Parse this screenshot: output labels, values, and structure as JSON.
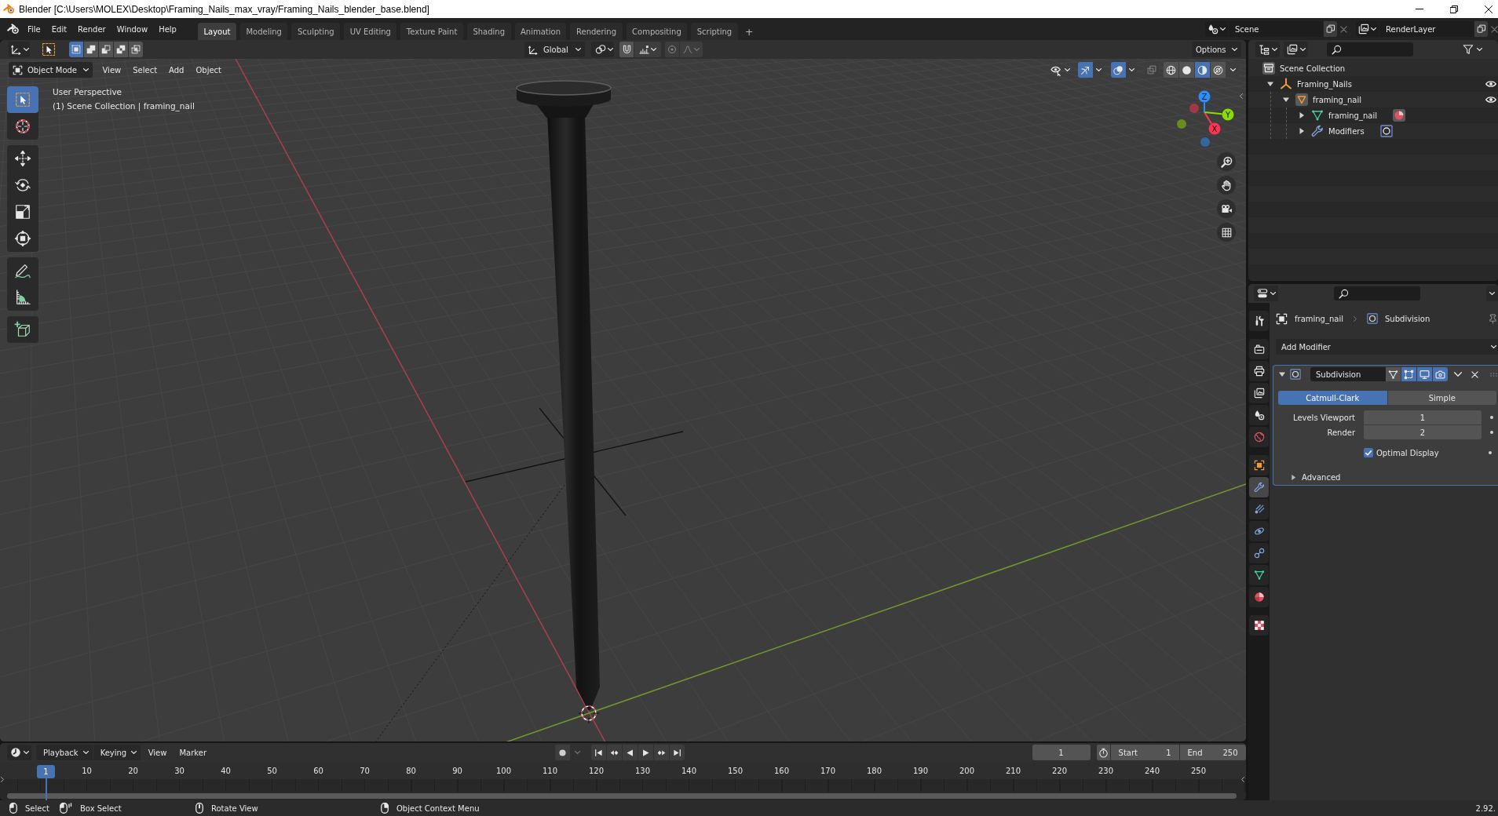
{
  "window": {
    "title": "Blender [C:\\Users\\MOLEX\\Desktop\\Framing_Nails_max_vray/Framing_Nails_blender_base.blend]"
  },
  "top_bar": {
    "menu": [
      "File",
      "Edit",
      "Render",
      "Window",
      "Help"
    ],
    "workspaces": [
      {
        "label": "Layout",
        "selected": true
      },
      {
        "label": "Modeling",
        "selected": false
      },
      {
        "label": "Sculpting",
        "selected": false
      },
      {
        "label": "UV Editing",
        "selected": false
      },
      {
        "label": "Texture Paint",
        "selected": false
      },
      {
        "label": "Shading",
        "selected": false
      },
      {
        "label": "Animation",
        "selected": false
      },
      {
        "label": "Rendering",
        "selected": false
      },
      {
        "label": "Compositing",
        "selected": false
      },
      {
        "label": "Scripting",
        "selected": false
      }
    ],
    "add_workspace": "+",
    "scene": "Scene",
    "view_layer": "RenderLayer"
  },
  "tool_header": {
    "select_modes": [
      {
        "kind": "set",
        "selected": true
      },
      {
        "kind": "extend",
        "selected": false
      },
      {
        "kind": "subtract",
        "selected": false
      },
      {
        "kind": "invert",
        "selected": false
      },
      {
        "kind": "intersect",
        "selected": false
      }
    ],
    "orientation": "Global",
    "snap": false,
    "proportional": false,
    "options": "Options"
  },
  "viewport": {
    "mode": "Object Mode",
    "menus": [
      "View",
      "Select",
      "Add",
      "Object"
    ],
    "gizmos": true,
    "overlays": true,
    "xray": false,
    "shading": [
      {
        "kind": "wireframe",
        "selected": false
      },
      {
        "kind": "solid",
        "selected": false
      },
      {
        "kind": "material",
        "selected": true
      },
      {
        "kind": "rendered",
        "selected": false
      }
    ],
    "tools": [
      {
        "kind": "select_box",
        "selected": true
      },
      {
        "kind": "cursor",
        "selected": false
      },
      {
        "kind": "move",
        "selected": false
      },
      {
        "kind": "rotate",
        "selected": false
      },
      {
        "kind": "scale",
        "selected": false
      },
      {
        "kind": "transform",
        "selected": false
      },
      {
        "kind": "annotate",
        "selected": false
      },
      {
        "kind": "measure",
        "selected": false
      },
      {
        "kind": "add_cube",
        "selected": false
      }
    ],
    "view_name": "User Perspective",
    "context": "(1) Scene Collection | framing_nail",
    "axes": [
      {
        "label": "X",
        "color": "#ff3352"
      },
      {
        "label": "Y",
        "color": "#8bdc00"
      },
      {
        "label": "Z",
        "color": "#2890ff"
      }
    ]
  },
  "outliner": {
    "items": [
      {
        "label": "Scene Collection",
        "kind": "collection",
        "children": [
          {
            "label": "Framing_Nails",
            "kind": "empty",
            "expanded": true,
            "visible": true,
            "children": [
              {
                "label": "framing_nail",
                "kind": "mesh_object",
                "expanded": true,
                "visible": true,
                "children": [
                  {
                    "label": "framing_nail",
                    "kind": "mesh",
                    "expanded": false
                  },
                  {
                    "label": "Modifiers",
                    "kind": "modifiers",
                    "expanded": false
                  }
                ]
              }
            ]
          }
        ]
      }
    ]
  },
  "properties": {
    "tabs": [
      {
        "kind": "tool",
        "selected": false
      },
      {
        "kind": "render",
        "selected": false
      },
      {
        "kind": "output",
        "selected": false
      },
      {
        "kind": "view_layer",
        "selected": false
      },
      {
        "kind": "scene",
        "selected": false
      },
      {
        "kind": "world",
        "selected": false
      },
      {
        "kind": "object",
        "selected": false
      },
      {
        "kind": "modifiers",
        "selected": true
      },
      {
        "kind": "particles",
        "selected": false
      },
      {
        "kind": "physics",
        "selected": false
      },
      {
        "kind": "constraints",
        "selected": false
      },
      {
        "kind": "data",
        "selected": false
      },
      {
        "kind": "material",
        "selected": false
      },
      {
        "kind": "texture",
        "selected": false
      }
    ],
    "breadcrumb": [
      {
        "kind": "object",
        "label": "framing_nail"
      },
      {
        "kind": "modifier",
        "label": "Subdivision"
      }
    ],
    "add_modifier": "Add Modifier",
    "modifiers": [
      {
        "name": "Subdivision",
        "expanded": true,
        "on_cage": false,
        "edit_mode": true,
        "show_viewport": true,
        "show_render": true,
        "algorithms": [
          {
            "label": "Catmull-Clark",
            "selected": true
          },
          {
            "label": "Simple",
            "selected": false
          }
        ],
        "levels": [
          {
            "label": "Levels Viewport",
            "value": "1"
          },
          {
            "label": "Render",
            "value": "2"
          }
        ],
        "options": [
          {
            "label": "Optimal Display",
            "checked": true
          }
        ],
        "subpanels": [
          {
            "label": "Advanced",
            "expanded": false
          }
        ]
      }
    ]
  },
  "timeline": {
    "menus": [
      {
        "kind": "dropdown",
        "label": "Playback"
      },
      {
        "kind": "dropdown",
        "label": "Keying"
      },
      {
        "kind": "menu",
        "label": "View"
      },
      {
        "kind": "menu",
        "label": "Marker"
      }
    ],
    "auto_keying": false,
    "current_frame": "1",
    "start_label": "Start",
    "start": "1",
    "end_label": "End",
    "end": "250",
    "playhead": "1",
    "ruler": [
      "10",
      "20",
      "30",
      "40",
      "50",
      "60",
      "70",
      "80",
      "90",
      "100",
      "110",
      "120",
      "130",
      "140",
      "150",
      "160",
      "170",
      "180",
      "190",
      "200",
      "210",
      "220",
      "230",
      "240",
      "250"
    ]
  },
  "status_bar": {
    "items": [
      {
        "kind": "mouse_left",
        "label": "Select"
      },
      {
        "kind": "mouse_drag",
        "label": "Box Select"
      },
      {
        "kind": "mouse_middle",
        "label": "Rotate View"
      },
      {
        "kind": "mouse_right",
        "label": "Object Context Menu"
      }
    ],
    "version": "2.92."
  }
}
